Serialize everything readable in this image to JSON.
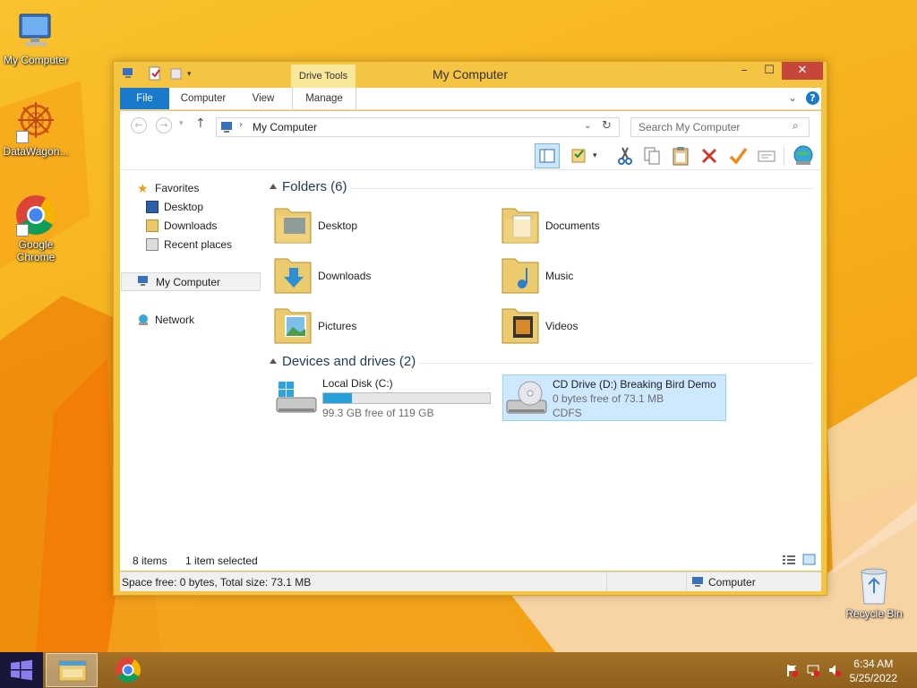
{
  "desktop": {
    "icons": [
      {
        "label": "My Computer"
      },
      {
        "label": "DataWagon..."
      },
      {
        "label": "Google Chrome"
      },
      {
        "label": "Recycle Bin"
      }
    ]
  },
  "window": {
    "title": "My Computer",
    "contextual_tab": "Drive Tools",
    "controls": {
      "minimize": "–",
      "maximize": "☐",
      "close": "✕"
    },
    "ribbon_tabs": [
      "File",
      "Computer",
      "View",
      "Manage"
    ],
    "address": {
      "path": "My Computer",
      "search_placeholder": "Search My Computer"
    },
    "nav": {
      "favorites": "Favorites",
      "favorites_items": [
        "Desktop",
        "Downloads",
        "Recent places"
      ],
      "my_computer": "My Computer",
      "network": "Network"
    },
    "folders_header": "Folders (6)",
    "folders": [
      "Desktop",
      "Documents",
      "Downloads",
      "Music",
      "Pictures",
      "Videos"
    ],
    "drives_header": "Devices and drives (2)",
    "drives": [
      {
        "name": "Local Disk (C:)",
        "free_text": "99.3 GB free of 119 GB",
        "used_fraction": 0.17
      },
      {
        "name": "CD Drive (D:) Breaking Bird Demo",
        "free_text": "0 bytes free of 73.1 MB",
        "fs": "CDFS"
      }
    ],
    "status": {
      "items": "8 items",
      "selected": "1 item selected",
      "space": "Space free: 0 bytes, Total size: 73.1 MB",
      "location": "Computer"
    }
  },
  "taskbar": {
    "time": "6:34 AM",
    "date": "5/25/2022"
  },
  "colors": {
    "accent": "#1979ca",
    "window_frame": "#f5c443",
    "selection": "#cde8ff",
    "close_button": "#c7463c"
  }
}
